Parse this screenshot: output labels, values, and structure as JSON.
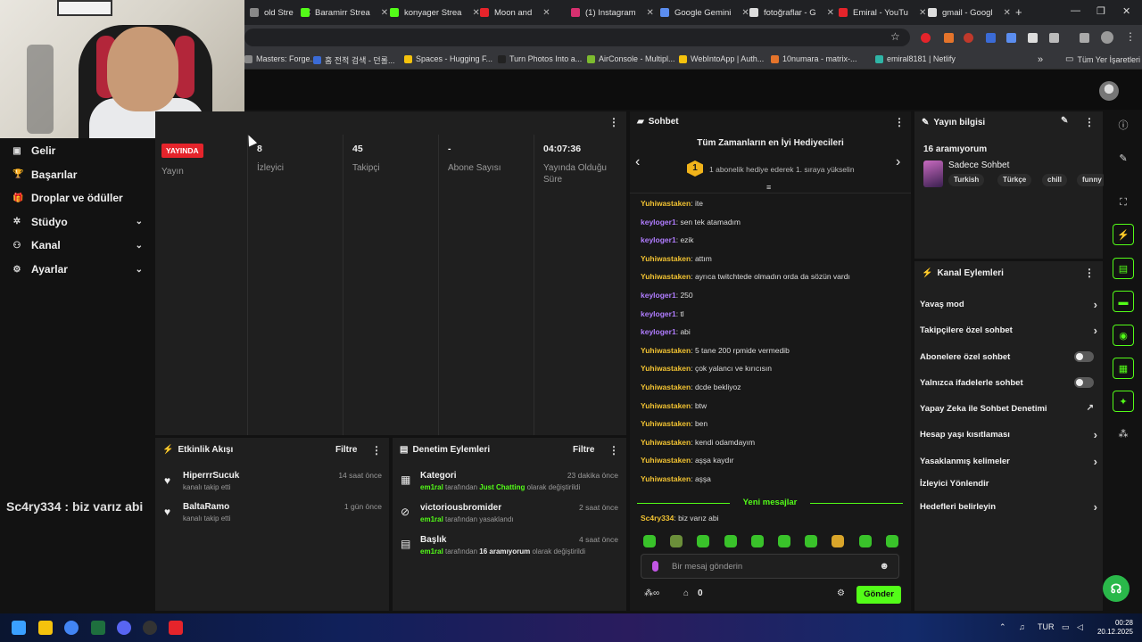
{
  "browser": {
    "tabs": [
      {
        "label": "old Stre",
        "color": "#888888"
      },
      {
        "label": "Baramirr Strea",
        "color": "#53fc18"
      },
      {
        "label": "konyager Strea",
        "color": "#53fc18"
      },
      {
        "label": "Moon and",
        "color": "#e5242b"
      },
      {
        "label": "(1) Instagram",
        "color": "#d6306f"
      },
      {
        "label": "Google Gemini",
        "color": "#5b8def"
      },
      {
        "label": "fotoğraflar - G",
        "color": "#dddddd"
      },
      {
        "label": "Emiral - YouTu",
        "color": "#e5242b"
      },
      {
        "label": "gmail - Googl",
        "color": "#dddddd"
      }
    ],
    "bookmarks": [
      {
        "label": "Masters: Forge...",
        "color": "#888888"
      },
      {
        "label": "홈 전적 검색 - 던롤...",
        "color": "#3b6bd6"
      },
      {
        "label": "Spaces - Hugging F...",
        "color": "#f4c20d"
      },
      {
        "label": "Turn Photos Into a...",
        "color": "#222222"
      },
      {
        "label": "AirConsole - Multipl...",
        "color": "#7dbb2f"
      },
      {
        "label": "WebIntoApp | Auth...",
        "color": "#f4c20d"
      },
      {
        "label": "10numara - matrix-...",
        "color": "#e5742b"
      },
      {
        "label": "emiral8181 | Netlify",
        "color": "#2fb5a6"
      }
    ],
    "all_bookmarks": "Tüm Yer İşaretleri"
  },
  "nav": {
    "items": [
      {
        "label": "Gelir",
        "icon": "wallet-icon",
        "glyph": "▣"
      },
      {
        "label": "Başarılar",
        "icon": "trophy-icon",
        "glyph": "🏆"
      },
      {
        "label": "Droplar ve ödüller",
        "icon": "gift-icon",
        "glyph": "🎁"
      },
      {
        "label": "Stüdyo",
        "icon": "studio-icon",
        "glyph": "✲"
      },
      {
        "label": "Kanal",
        "icon": "user-icon",
        "glyph": "⚇"
      },
      {
        "label": "Ayarlar",
        "icon": "gear-icon",
        "glyph": "⚙"
      }
    ]
  },
  "overlay_chat": {
    "user": "Sc4ry334",
    "text": ": biz varız abi"
  },
  "stats": {
    "live_badge": "YAYINDA",
    "live_label": "Yayın",
    "viewers": "8",
    "viewers_label": "İzleyici",
    "followers": "45",
    "followers_label": "Takipçi",
    "subs": "-",
    "subs_label": "Abone Sayısı",
    "uptime": "04:07:36",
    "uptime_label": "Yayında Olduğu Süre"
  },
  "feed": {
    "title": "Etkinlik Akışı",
    "filter": "Filtre",
    "items": [
      {
        "name": "HiperrrSucuk",
        "sub": "kanalı takip etti",
        "time": "14 saat önce"
      },
      {
        "name": "BaltaRamo",
        "sub": "kanalı takip etti",
        "time": "1 gün önce"
      }
    ]
  },
  "mod": {
    "title": "Denetim Eylemleri",
    "filter": "Filtre",
    "items": [
      {
        "name": "Kategori",
        "by": "em1ral",
        "mid": "tarafından",
        "val": "Just Chatting",
        "tail": "olarak değiştirildi",
        "time": "23 dakika önce"
      },
      {
        "name": "victoriousbromider",
        "by": "em1ral",
        "mid": "tarafından yasaklandı",
        "time": "2 saat önce"
      },
      {
        "name": "Başlık",
        "by": "em1ral",
        "mid": "tarafından",
        "val": "16 aramıyorum",
        "tail": "olarak değiştirildi",
        "time": "4 saat önce"
      }
    ]
  },
  "chat": {
    "title": "Sohbet",
    "gifters_title": "Tüm Zamanların en İyi Hediyecileri",
    "gifter_rank": "1",
    "gifters_sub": "1 abonelik hediye ederek 1. sıraya yükselin",
    "messages": [
      {
        "user": "Yuhiwastaken",
        "text": "ite",
        "color": "#f1c232"
      },
      {
        "user": "keyloger1",
        "text": "sen tek atamadım",
        "color": "#b07cff"
      },
      {
        "user": "keyloger1",
        "text": "ezik",
        "color": "#b07cff"
      },
      {
        "user": "Yuhiwastaken",
        "text": "attım",
        "color": "#f1c232"
      },
      {
        "user": "Yuhiwastaken",
        "text": "ayrıca twitchtede olmadın orda da sözün vardı",
        "color": "#f1c232"
      },
      {
        "user": "keyloger1",
        "text": "250",
        "color": "#b07cff"
      },
      {
        "user": "keyloger1",
        "text": "tl",
        "color": "#b07cff"
      },
      {
        "user": "keyloger1",
        "text": "abi",
        "color": "#b07cff"
      },
      {
        "user": "Yuhiwastaken",
        "text": "5 tane 200 rpmide vermedib",
        "color": "#f1c232"
      },
      {
        "user": "Yuhiwastaken",
        "text": "çok yalancı ve kırıcısın",
        "color": "#f1c232"
      },
      {
        "user": "Yuhiwastaken",
        "text": "dcde bekliyoz",
        "color": "#f1c232"
      },
      {
        "user": "Yuhiwastaken",
        "text": "btw",
        "color": "#f1c232"
      },
      {
        "user": "Yuhiwastaken",
        "text": "ben",
        "color": "#f1c232"
      },
      {
        "user": "Yuhiwastaken",
        "text": "kendi odamdayım",
        "color": "#f1c232"
      },
      {
        "user": "Yuhiwastaken",
        "text": "aşşa kaydır",
        "color": "#f1c232"
      },
      {
        "user": "Yuhiwastaken",
        "text": "aşşa",
        "color": "#f1c232"
      }
    ],
    "new_messages": "Yeni mesajlar",
    "last_message": {
      "user": "Sc4ry334",
      "text": "biz varız abi",
      "color": "#f1c232"
    },
    "input_placeholder": "Bir mesaj gönderin",
    "points": "0",
    "send": "Gönder"
  },
  "info": {
    "title": "Yayın bilgisi",
    "stream_title": "16 aramıyorum",
    "category": "Sadece Sohbet",
    "tags": [
      "Turkish",
      "Türkçe",
      "chill",
      "funny"
    ]
  },
  "actions": {
    "title": "Kanal Eylemleri",
    "items": [
      {
        "label": "Yavaş mod",
        "kind": "chevron"
      },
      {
        "label": "Takipçilere özel sohbet",
        "kind": "chevron"
      },
      {
        "label": "Abonelere özel sohbet",
        "kind": "toggle"
      },
      {
        "label": "Yalnızca ifadelerle sohbet",
        "kind": "toggle"
      },
      {
        "label": "Yapay Zeka ile Sohbet Denetimi",
        "kind": "external"
      },
      {
        "label": "Hesap yaşı kısıtlaması",
        "kind": "chevron"
      },
      {
        "label": "Yasaklanmış kelimeler",
        "kind": "chevron"
      },
      {
        "label": "İzleyici Yönlendir",
        "kind": "none"
      },
      {
        "label": "Hedefleri belirleyin",
        "kind": "chevron"
      }
    ]
  },
  "taskbar": {
    "lang": "TUR",
    "time": "00:28",
    "date": "20.12.2025"
  }
}
